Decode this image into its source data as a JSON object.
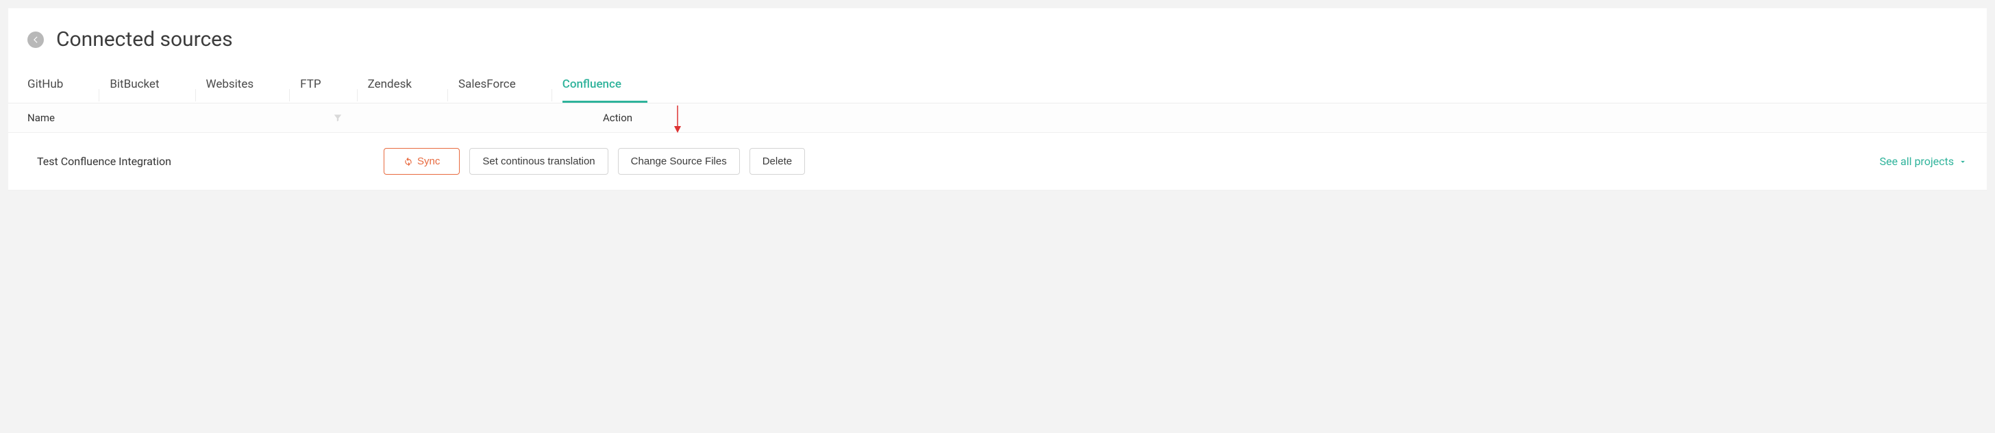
{
  "header": {
    "title": "Connected sources"
  },
  "tabs": [
    {
      "label": "GitHub",
      "active": false
    },
    {
      "label": "BitBucket",
      "active": false
    },
    {
      "label": "Websites",
      "active": false
    },
    {
      "label": "FTP",
      "active": false
    },
    {
      "label": "Zendesk",
      "active": false
    },
    {
      "label": "SalesForce",
      "active": false
    },
    {
      "label": "Confluence",
      "active": true
    }
  ],
  "columns": {
    "name": "Name",
    "action": "Action"
  },
  "row": {
    "name": "Test Confluence Integration",
    "sync": "Sync",
    "set_ct": "Set continous translation",
    "change_src": "Change Source Files",
    "delete": "Delete",
    "see_all": "See all projects"
  }
}
